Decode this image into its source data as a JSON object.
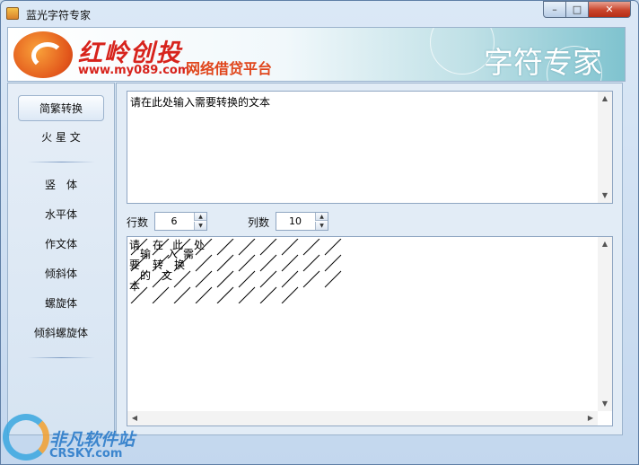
{
  "window": {
    "title": "蓝光字符专家",
    "minimize_glyph": "–",
    "maximize_glyph": "□",
    "close_glyph": "✕"
  },
  "banner": {
    "brand_cn": "红岭创投",
    "brand_url": "www.my089.com",
    "brand_sub": "网络借贷平台",
    "app_title": "字符专家"
  },
  "sidebar": {
    "items": [
      {
        "label": "简繁转换",
        "active": true
      },
      {
        "label": "火 星 文",
        "active": false
      },
      {
        "label": "竖　体",
        "active": false
      },
      {
        "label": "水平体",
        "active": false
      },
      {
        "label": "作文体",
        "active": false
      },
      {
        "label": "倾斜体",
        "active": false
      },
      {
        "label": "螺旋体",
        "active": false
      },
      {
        "label": "倾斜螺旋体",
        "active": false
      }
    ]
  },
  "input": {
    "text": "请在此处输入需要转换的文本"
  },
  "controls": {
    "rows_label": "行数",
    "rows_value": "6",
    "cols_label": "列数",
    "cols_value": "10"
  },
  "output": {
    "chars": "请在此处输入需要转换的文本",
    "slash_count": 38
  },
  "watermark": {
    "name": "非凡软件站",
    "url": "CRSKY.com"
  },
  "colors": {
    "brand_red": "#d7231c",
    "title_white": "#ffffff",
    "accent_blue": "#2477c8"
  }
}
